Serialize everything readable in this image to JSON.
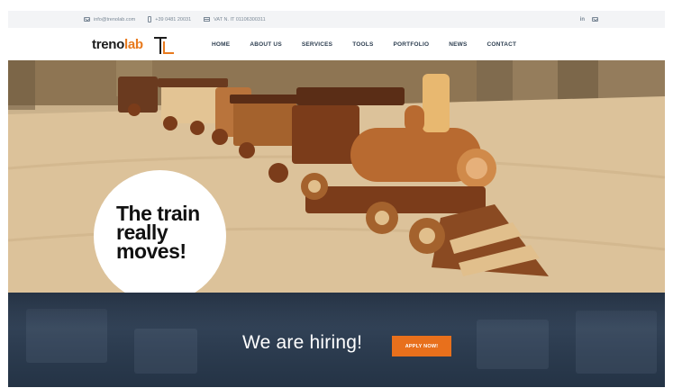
{
  "topbar": {
    "email": "info@trenolab.com",
    "phone": "+39 0481 20031",
    "vat": "VAT N. IT 01106300311",
    "icons": [
      "mail-icon",
      "phone-icon",
      "card-icon",
      "linkedin-icon",
      "mail-icon"
    ],
    "linkedin_label": "in"
  },
  "header": {
    "logo_part1": "treno",
    "logo_part2": "lab",
    "nav": [
      "HOME",
      "ABOUT US",
      "SERVICES",
      "TOOLS",
      "PORTFOLIO",
      "NEWS",
      "CONTACT"
    ]
  },
  "hero": {
    "line1": "The train",
    "line2": "really",
    "line3": "moves!"
  },
  "hiring": {
    "title": "We are hiring!",
    "button": "APPLY NOW!"
  },
  "colors": {
    "accent": "#e8701c",
    "nav_text": "#2d3e50",
    "band": "#2e3e52"
  }
}
